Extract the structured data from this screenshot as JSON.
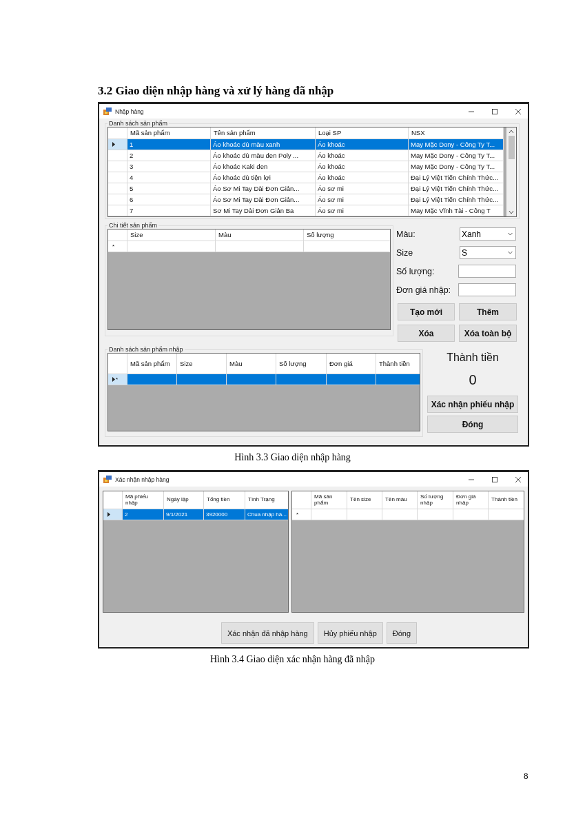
{
  "heading": "3.2 Giao diện nhập hàng và xử lý hàng đã nhập",
  "import_window": {
    "title": "Nhập hàng",
    "product_list": {
      "label": "Danh sách sản phẩm",
      "columns": [
        "Mã sản phẩm",
        "Tên sản phẩm",
        "Loại SP",
        "NSX"
      ],
      "rows": [
        {
          "cells": [
            "1",
            "Áo khoác dù màu xanh",
            "Áo khoác",
            "May Mặc Dony - Công Ty T..."
          ],
          "selected": true
        },
        {
          "cells": [
            "2",
            "Áo khoác dù màu đen Poly ...",
            "Áo khoác",
            "May Mặc Dony - Công Ty T..."
          ],
          "selected": false
        },
        {
          "cells": [
            "3",
            "Áo khoác Kaki đen",
            "Áo khoác",
            "May Mặc Dony - Công Ty T..."
          ],
          "selected": false
        },
        {
          "cells": [
            "4",
            "Áo khoác dù tiện lợi",
            "Áo khoác",
            "Đại Lý Việt Tiến Chính Thức..."
          ],
          "selected": false
        },
        {
          "cells": [
            "5",
            "Áo Sơ Mi Tay Dài Đơn Giản...",
            "Áo sơ mi",
            "Đại Lý Việt Tiến Chính Thức..."
          ],
          "selected": false
        },
        {
          "cells": [
            "6",
            "Áo Sơ Mi Tay Dài Đơn Giản...",
            "Áo sơ mi",
            "Đại Lý Việt Tiến Chính Thức..."
          ],
          "selected": false
        },
        {
          "cells": [
            "7",
            "Sơ Mi Tay Dài Đơn Giản Ba",
            "Áo sơ mi",
            "May Mặc Vĩnh Tài - Công T"
          ],
          "selected": false
        }
      ]
    },
    "detail": {
      "label": "Chi tiết sản phẩm",
      "columns": [
        "Size",
        "Màu",
        "Số lượng"
      ],
      "rows": [
        {
          "marker": "*",
          "selected": false
        }
      ]
    },
    "form": {
      "color_label": "Màu:",
      "color_value": "Xanh",
      "size_label": "Size",
      "size_value": "S",
      "qty_label": "Số lượng:",
      "price_label": "Đơn giá nhập:"
    },
    "form_buttons": [
      "Tạo mới",
      "Thêm",
      "Xóa",
      "Xóa toàn bộ"
    ],
    "import_list": {
      "label": "Danh sách sản phẩm nhập",
      "columns": [
        "Mã sản phẩm",
        "Size",
        "Màu",
        "Số lượng",
        "Đơn giá",
        "Thành tiền"
      ],
      "rows": [
        {
          "marker": "*",
          "selected": true
        }
      ]
    },
    "total_label": "Thành tiền",
    "total": "0",
    "buttons": [
      "Xác nhận phiếu nhập",
      "Đóng"
    ]
  },
  "caption_1": "Hình 3.3 Giao diện nhập hàng",
  "confirm_window": {
    "title": "Xác nhận nhập hàng",
    "receipts": {
      "columns": [
        "Mã phiếu nhập",
        "Ngày lập",
        "Tổng tiền",
        "Tình Trạng"
      ],
      "rows": [
        {
          "cells": [
            "2",
            "9/1/2021",
            "3920000",
            "Chua nhập hà..."
          ],
          "selected": true
        }
      ]
    },
    "items": {
      "columns": [
        "Mã sản phẩm",
        "Tên size",
        "Tên màu",
        "Số lượng nhập",
        "Đơn giá nhập",
        "Thành tiền"
      ],
      "rows": [
        {
          "marker": "*",
          "selected": false
        }
      ]
    },
    "buttons": [
      "Xác nhận đã nhập hàng",
      "Hủy phiếu nhập",
      "Đóng"
    ]
  },
  "caption_2": "Hình 3.4 Giao diện xác nhận hàng đã nhập",
  "page_number": "8"
}
